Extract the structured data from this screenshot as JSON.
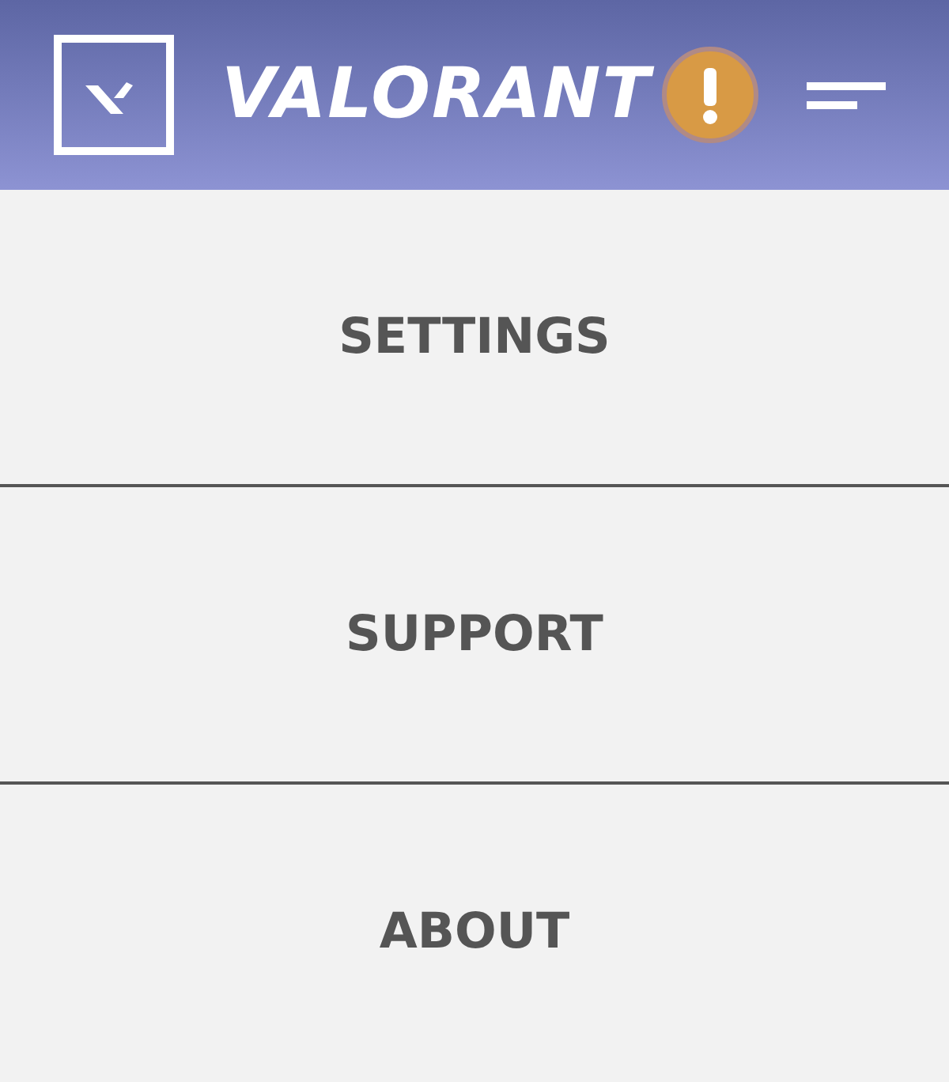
{
  "header": {
    "brand": "VALORANT",
    "alert": true
  },
  "menu": [
    {
      "label": "SETTINGS"
    },
    {
      "label": "SUPPORT"
    },
    {
      "label": "ABOUT"
    }
  ]
}
